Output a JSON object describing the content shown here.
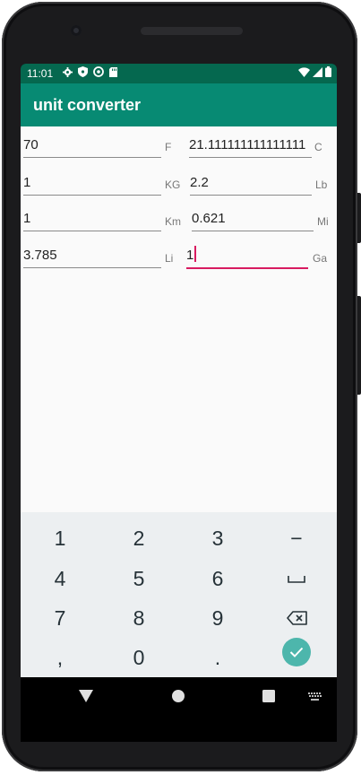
{
  "status_bar": {
    "time": "11:01",
    "left_icons": [
      "gear-icon",
      "shield-icon",
      "sync-icon",
      "sd-card-icon"
    ],
    "right_icons": [
      "wifi-icon",
      "signal-icon",
      "battery-icon"
    ]
  },
  "app_bar": {
    "title": "unit converter"
  },
  "rows": [
    {
      "left_value": "70",
      "left_unit": "F",
      "right_value": "21.111111111111111",
      "right_unit": "C"
    },
    {
      "left_value": "1",
      "left_unit": "KG",
      "right_value": "2.2",
      "right_unit": "Lb"
    },
    {
      "left_value": "1",
      "left_unit": "Km",
      "right_value": "0.621",
      "right_unit": "Mi"
    },
    {
      "left_value": "3.785",
      "left_unit": "Li",
      "right_value": "1",
      "right_unit": "Ga"
    }
  ],
  "keyboard": {
    "keys": [
      "1",
      "2",
      "3",
      "−",
      "4",
      "5",
      "6",
      "␣",
      "7",
      "8",
      "9",
      "⌫",
      ",",
      "0",
      ".",
      "✓"
    ]
  },
  "nav_bar": {
    "icons": [
      "back-icon",
      "home-icon",
      "recents-icon",
      "keyboard-switch-icon"
    ]
  },
  "colors": {
    "status_bar": "#05684f",
    "app_bar": "#078a73",
    "accent": "#d81b60",
    "enter_key": "#4db6ac"
  }
}
